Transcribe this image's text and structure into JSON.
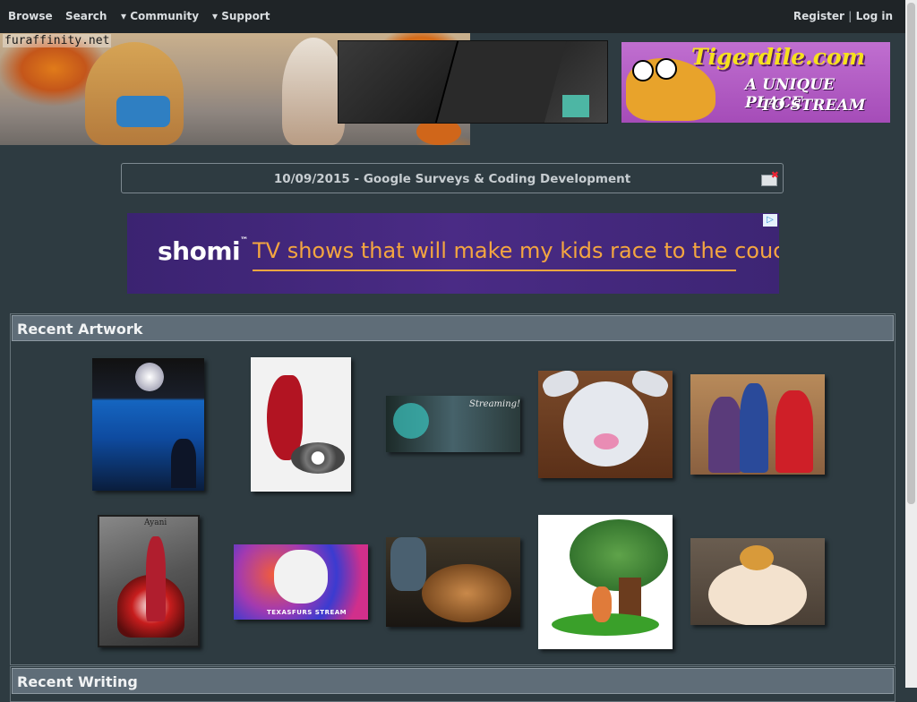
{
  "topnav": {
    "browse": "Browse",
    "search": "Search",
    "community": "▾ Community",
    "support": "▾ Support",
    "register": "Register",
    "separator": "|",
    "login": "Log in"
  },
  "header": {
    "logo_text": "furaffinity.net"
  },
  "ad_tigerdile": {
    "title": "Tigerdile.com",
    "tagline_1": "A UNIQUE PLACE",
    "tagline_2": "TO STREAM"
  },
  "news": {
    "text": "10/09/2015 - Google Surveys & Coding Development"
  },
  "ad_shomi": {
    "brand": "shomi",
    "tm": "™",
    "slogan": "TV shows that will make my kids race to the couc",
    "adchoices_icon": "adchoices-icon"
  },
  "recent_artwork": {
    "title": "Recent Artwork",
    "thumbs": [
      {
        "caption": ""
      },
      {
        "caption": ""
      },
      {
        "caption": "Streaming!"
      },
      {
        "caption": ""
      },
      {
        "caption": ""
      },
      {
        "caption": "Ayani"
      },
      {
        "caption": "TEXASFURS STREAM"
      },
      {
        "caption": ""
      },
      {
        "caption": ""
      },
      {
        "caption": ""
      }
    ]
  },
  "recent_writing": {
    "title": "Recent Writing"
  },
  "colors": {
    "page_bg": "#2e3b41",
    "nav_bg": "#1f2427",
    "section_head_bg": "#5f6d78",
    "shomi_accent": "#f4a640",
    "tigerdile_yellow": "#f6e11d"
  }
}
